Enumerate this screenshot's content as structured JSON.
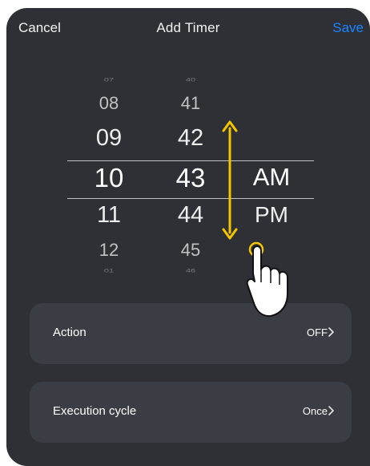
{
  "nav": {
    "cancel": "Cancel",
    "title": "Add Timer",
    "save": "Save"
  },
  "picker": {
    "hours": [
      "07",
      "08",
      "09",
      "10",
      "11",
      "12",
      "01"
    ],
    "minutes": [
      "40",
      "41",
      "42",
      "43",
      "44",
      "45",
      "46"
    ],
    "periods": [
      "AM",
      "PM"
    ],
    "selected": {
      "hour": "10",
      "minute": "43",
      "period": "AM"
    }
  },
  "settings": {
    "action": {
      "label": "Action",
      "value": "OFF"
    },
    "cycle": {
      "label": "Execution cycle",
      "value": "Once"
    }
  },
  "colors": {
    "background": "#2e3036",
    "card": "#3b3d44",
    "accent": "#1d84ff",
    "arrow": "#f5c400"
  },
  "icons": {
    "scroll_arrow": "double-arrow-vertical-icon",
    "gesture": "hand-pointer-icon",
    "chevron": "chevron-right-icon"
  }
}
